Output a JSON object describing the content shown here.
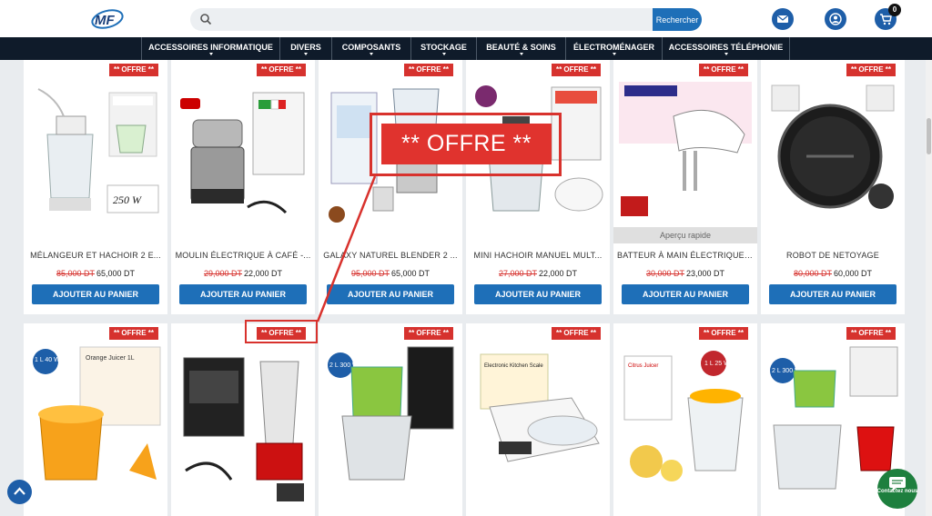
{
  "header": {
    "logo_text": "MF",
    "search": {
      "placeholder": "",
      "button_label": "Rechercher"
    },
    "cart_count": "0"
  },
  "nav": {
    "items": [
      {
        "label": "ACCESSOIRES INFORMATIQUE"
      },
      {
        "label": "DIVERS"
      },
      {
        "label": "COMPOSANTS"
      },
      {
        "label": "STOCKAGE"
      },
      {
        "label": "BEAUTÉ & SOINS"
      },
      {
        "label": "ÉLECTROMÉNAGER"
      },
      {
        "label": "ACCESSOIRES TÉLÉPHONIE"
      }
    ]
  },
  "products": {
    "badge": "** OFFRE **",
    "cart_label": "AJOUTER AU PANIER",
    "quick_view": "Aperçu rapide",
    "row1": [
      {
        "name": "MÉLANGEUR ET HACHOIR 2 E...",
        "old_price": "85,000 DT",
        "price": "65,000 DT",
        "image_icon": "blender-chopper"
      },
      {
        "name": "MOULIN ÉLECTRIQUE À CAFÉ -...",
        "old_price": "29,000 DT",
        "price": "22,000 DT",
        "image_icon": "coffee-grinder"
      },
      {
        "name": "GALAXY NATUREL BLENDER 2 ...",
        "old_price": "95,000 DT",
        "price": "65,000 DT",
        "image_icon": "blender"
      },
      {
        "name": "MINI HACHOIR MANUEL MULT...",
        "old_price": "27,000 DT",
        "price": "22,000 DT",
        "image_icon": "manual-chopper"
      },
      {
        "name": "BATTEUR À MAIN ÉLECTRIQUE ...",
        "old_price": "30,000 DT",
        "price": "23,000 DT",
        "image_icon": "hand-mixer"
      },
      {
        "name": "ROBOT DE NETOYAGE",
        "old_price": "80,000 DT",
        "price": "60,000 DT",
        "image_icon": "robot-vacuum"
      }
    ],
    "row2": [
      {
        "image_icon": "citrus-juicer",
        "label_a": "Orange Juicer 1L",
        "tag": "1 L 40 W"
      },
      {
        "image_icon": "blender-black"
      },
      {
        "image_icon": "electric-chopper",
        "tag": "2 L 300 W"
      },
      {
        "image_icon": "kitchen-scale",
        "label_a": "Electronic Kitchen Scale"
      },
      {
        "image_icon": "citrus-juicer-white",
        "label_a": "Citrus Juicer",
        "tag": "1 L 25 W"
      },
      {
        "image_icon": "chopper-green",
        "tag": "2 L 300 W"
      }
    ]
  },
  "callout": {
    "text": "** OFFRE **"
  },
  "chat": {
    "label": "Contactez nous"
  },
  "colors": {
    "brand": "#1e6fb8",
    "nav_bg": "#0f1b2a",
    "offer": "#d6322e",
    "chat": "#1e7f3e"
  }
}
